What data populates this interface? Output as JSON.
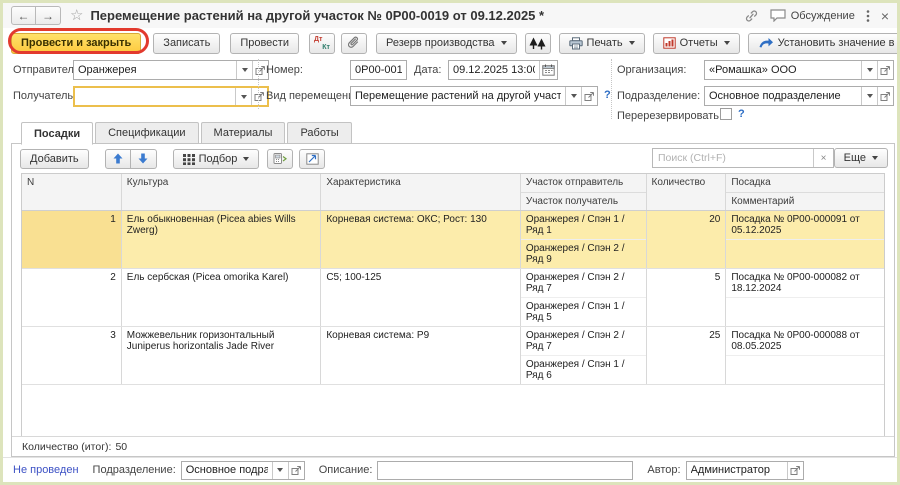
{
  "colors": {
    "accent_button": "#ffd34e",
    "annotation_ring": "#e23a2e",
    "required_field_border": "#ecbf4c",
    "selected_row": "#fcecab",
    "link_blue": "#3d52c5",
    "window_border": "#dde4bc"
  },
  "titlebar": {
    "title": "Перемещение растений на другой участок № 0Р00-0019 от 09.12.2025 *",
    "discussion": "Обсуждение"
  },
  "glyphs": {
    "back": "←",
    "forward": "→",
    "star": "☆",
    "close": "×",
    "help": "?",
    "clear": "×"
  },
  "command_bar": {
    "post_and_close": "Провести и закрыть",
    "write": "Записать",
    "post": "Провести",
    "dt": "Дт",
    "kt": "Кт",
    "production_reserve": "Резерв производства",
    "print": "Печать",
    "reports": "Отчеты",
    "set_column_value": "Установить значение в колонке",
    "more": "Еще",
    "help": "?"
  },
  "form": {
    "sender": {
      "label": "Отправитель:",
      "value": "Оранжерея"
    },
    "receiver": {
      "label": "Получатель:",
      "value": ""
    },
    "number": {
      "label": "Номер:",
      "value": "0Р00-001"
    },
    "date": {
      "label": "Дата:",
      "value": "09.12.2025 13:00:"
    },
    "movement_type": {
      "label": "Вид перемещения:",
      "value": "Перемещение растений на другой участок"
    },
    "organization": {
      "label": "Организация:",
      "value": "«Ромашка» ООО"
    },
    "department": {
      "label": "Подразделение:",
      "value": "Основное подразделение"
    },
    "rereserve": {
      "label": "Перерезервировать:"
    }
  },
  "tabs": {
    "items": [
      {
        "label": "Посадки"
      },
      {
        "label": "Спецификации"
      },
      {
        "label": "Материалы"
      },
      {
        "label": "Работы"
      }
    ]
  },
  "grid_toolbar": {
    "add": "Добавить",
    "pick": "Подбор",
    "search_placeholder": "Поиск (Ctrl+F)",
    "more": "Еще"
  },
  "grid": {
    "headers": {
      "n": "N",
      "culture": "Культура",
      "characteristic": "Характеристика",
      "plot_from": "Участок отправитель",
      "plot_to": "Участок получатель",
      "qty": "Количество",
      "planting": "Посадка",
      "comment": "Комментарий"
    },
    "rows": [
      {
        "n": "1",
        "culture": "Ель обыкновенная (Picea abies Wills Zwerg)",
        "characteristic": "Корневая система: ОКС; Рост: 130",
        "plot_from": "Оранжерея / Спэн 1 / Ряд 1",
        "plot_to": "Оранжерея / Спэн 2 / Ряд 9",
        "qty": "20",
        "planting": "Посадка № 0Р00-000091 от 05.12.2025",
        "comment": ""
      },
      {
        "n": "2",
        "culture": "Ель сербская (Picea omorika Karel)",
        "characteristic": "C5; 100-125",
        "plot_from": "Оранжерея / Спэн 2 / Ряд 7",
        "plot_to": "Оранжерея / Спэн 1 / Ряд 5",
        "qty": "5",
        "planting": "Посадка № 0Р00-000082 от 18.12.2024",
        "comment": ""
      },
      {
        "n": "3",
        "culture": "Можжевельник горизонтальный Juniperus horizontalis Jade River",
        "characteristic": "Корневая система: Р9",
        "plot_from": "Оранжерея / Спэн 2 / Ряд 7",
        "plot_to": "Оранжерея / Спэн 1 / Ряд 6",
        "qty": "25",
        "planting": "Посадка № 0Р00-000088 от 08.05.2025",
        "comment": ""
      }
    ]
  },
  "grid_footer": {
    "label": "Количество (итог):",
    "value": "50"
  },
  "statusbar": {
    "status": "Не проведен",
    "department": {
      "label": "Подразделение:",
      "value": "Основное подразделение"
    },
    "description": {
      "label": "Описание:",
      "value": ""
    },
    "author": {
      "label": "Автор:",
      "value": "Администратор"
    }
  }
}
